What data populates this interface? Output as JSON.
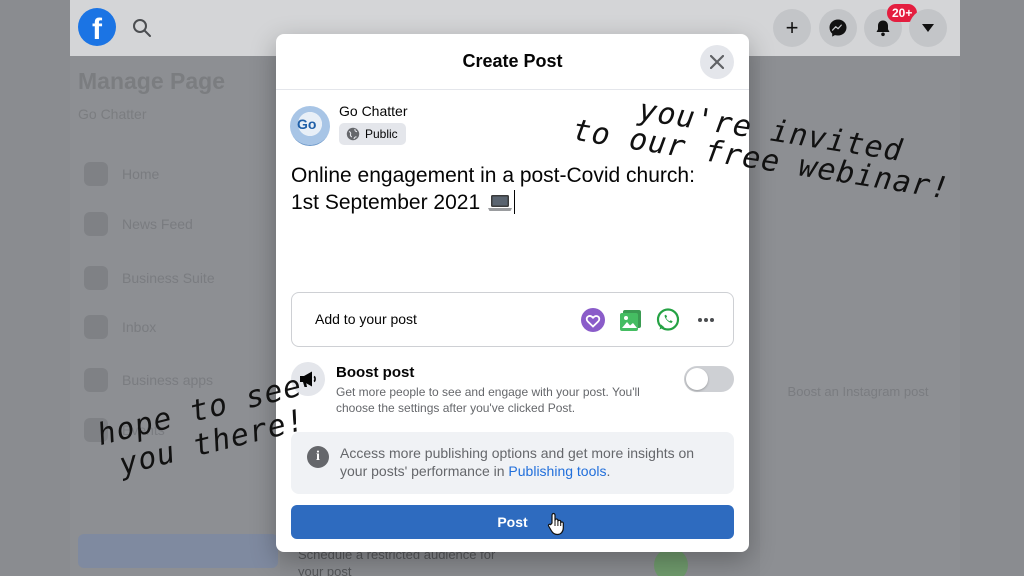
{
  "background": {
    "manage_page_title": "Manage Page",
    "page_subtitle": "Go Chatter",
    "sidebar_items": [
      "Home",
      "News Feed",
      "Business Suite",
      "Inbox",
      "Business apps",
      "Events"
    ],
    "right_panel_text": "Boost an Instagram post",
    "bottom_text": "Schedule a restricted audience for your post",
    "notification_count": "20+"
  },
  "modal": {
    "title": "Create Post",
    "page_name": "Go Chatter",
    "avatar_text": "Go",
    "audience": "Public",
    "post_text_line1": "Online engagement in a post-Covid church:",
    "post_text_line2": "1st September 2021",
    "add_to_post_label": "Add to your post",
    "boost_title": "Boost post",
    "boost_description": "Get more people to see and engage with your post. You'll choose the settings after you've clicked Post.",
    "boost_enabled": false,
    "info_text": "Access more publishing options and get more insights on your posts' performance in",
    "info_link": "Publishing tools",
    "info_period": ".",
    "post_button": "Post"
  },
  "annotations": {
    "right_line1": "you're invited",
    "right_line2": "to our free webinar!",
    "left_line1": "hope to see",
    "left_line2": "you there!"
  },
  "colors": {
    "facebook_blue": "#1b74e4",
    "post_button": "#2e6bbf",
    "badge_red": "#e41e3f",
    "link_blue": "#216fdb"
  },
  "icons": {
    "add_to_post": [
      "feeling-heart-icon",
      "photo-icon",
      "whatsapp-icon",
      "more-icon"
    ]
  }
}
